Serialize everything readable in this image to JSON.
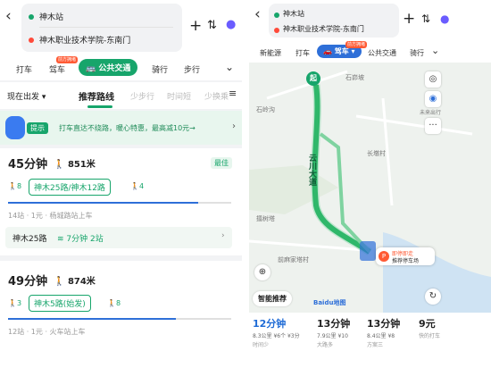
{
  "left": {
    "origin": "神木站",
    "destination": "神木职业技术学院-东南门",
    "modes": [
      {
        "label": "打车"
      },
      {
        "label": "驾车",
        "badge": "前方拥堵"
      },
      {
        "label": "公共交通"
      },
      {
        "label": "骑行"
      },
      {
        "label": "步行"
      }
    ],
    "depart_label": "现在出发",
    "sorts": [
      "推荐路线",
      "少步行",
      "时间短",
      "少换乘"
    ],
    "tip_label": "提示",
    "tip_text": "打车直达不绕路，暖心特惠，最高减10元→",
    "routes": [
      {
        "duration": "45分钟",
        "walk": "851米",
        "best_badge": "最佳",
        "walk_before": "8",
        "line": "神木25路/神木12路",
        "walk_after": "4",
        "meta": "14站 · 1元 · 杨城路站上车",
        "progress": 0.85,
        "realtime_line": "神木25路",
        "realtime_eta": "7分钟 2站"
      },
      {
        "duration": "49分钟",
        "walk": "874米",
        "walk_before": "3",
        "line": "神木5路(始发)",
        "walk_after": "8",
        "meta": "12站 · 1元 · 火车站上车",
        "progress": 0.75
      }
    ]
  },
  "right": {
    "origin": "神木站",
    "destination": "神木职业技术学院-东南门",
    "modes": [
      {
        "label": "新能源"
      },
      {
        "label": "打车"
      },
      {
        "label": "驾车",
        "badge": "前方拥堵"
      },
      {
        "label": "公共交通"
      },
      {
        "label": "骑行"
      }
    ],
    "start_marker": "起",
    "map_labels": [
      "石峁坡",
      "石岭沟",
      "长墩村",
      "擂树塔",
      "前麻家塔村"
    ],
    "road_labels": [
      "云川大道"
    ],
    "layer_label": "未来出行",
    "parking_title": "即停即走",
    "parking_sub": "推荐停车场",
    "smart_label": "智能推荐",
    "brand": "Baidu地图",
    "options": [
      {
        "time": "12分钟",
        "sub": "8.3公里 ¥6个 ¥3分",
        "note": "时间少"
      },
      {
        "time": "13分钟",
        "sub": "7.9公里 ¥10",
        "note": "大路多"
      },
      {
        "time": "13分钟",
        "sub": "8.4公里 ¥8",
        "note": "方案三"
      },
      {
        "time": "9元",
        "sub": "",
        "note": "快的打车"
      }
    ]
  },
  "colors": {
    "accent": "#17a56b",
    "route": "#2fb76a",
    "blue": "#2e6fd8"
  }
}
